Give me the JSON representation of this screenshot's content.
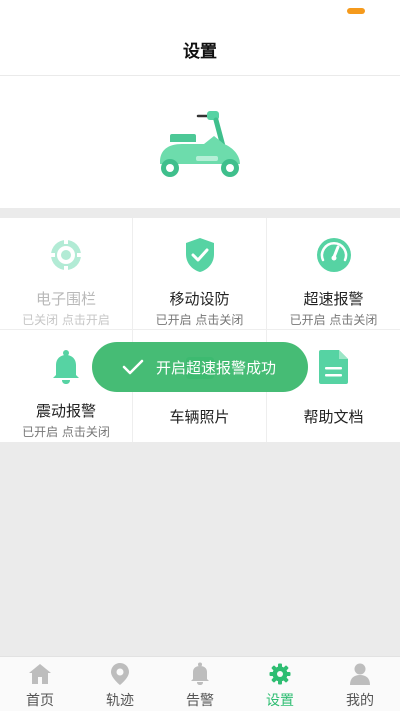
{
  "colors": {
    "accent": "#2ebd72",
    "icon_green": "#56d3a3",
    "toast_bg": "#3cb86e",
    "battery": "#f59a1c"
  },
  "header": {
    "title": "设置"
  },
  "features": [
    {
      "label": "电子围栏",
      "status": "已关闭 点击开启",
      "icon": "geofence-icon",
      "enabled": false
    },
    {
      "label": "移动设防",
      "status": "已开启 点击关闭",
      "icon": "shield-check-icon",
      "enabled": true
    },
    {
      "label": "超速报警",
      "status": "已开启 点击关闭",
      "icon": "speedometer-icon",
      "enabled": true
    },
    {
      "label": "震动报警",
      "status": "已开启 点击关闭",
      "icon": "bell-icon",
      "enabled": true
    },
    {
      "label": "车辆照片",
      "status": "",
      "icon": "photo-icon",
      "enabled": true
    },
    {
      "label": "帮助文档",
      "status": "",
      "icon": "document-icon",
      "enabled": true
    }
  ],
  "toast": {
    "text": "开启超速报警成功",
    "icon": "check-icon"
  },
  "tabbar": {
    "tabs": [
      {
        "label": "首页",
        "icon": "home-icon"
      },
      {
        "label": "轨迹",
        "icon": "location-pin-icon"
      },
      {
        "label": "告警",
        "icon": "bell-icon"
      },
      {
        "label": "设置",
        "icon": "gear-icon",
        "active": true
      },
      {
        "label": "我的",
        "icon": "person-icon"
      }
    ]
  }
}
